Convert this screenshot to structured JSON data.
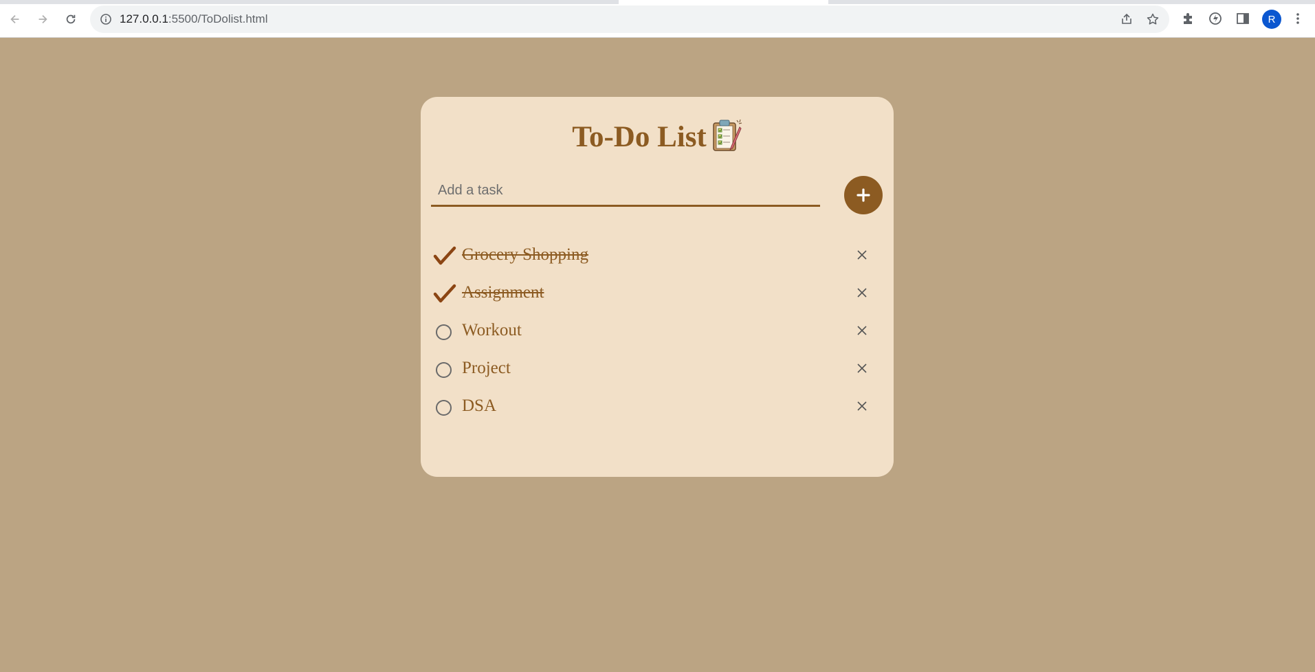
{
  "browser": {
    "url_host": "127.0.0.1",
    "url_path": ":5500/ToDolist.html",
    "profile_initial": "R"
  },
  "app": {
    "title": "To-Do List",
    "title_icon": "clipboard-checklist-emoji",
    "input_placeholder": "Add a task",
    "add_icon": "plus-icon",
    "delete_icon": "close-icon",
    "tasks": [
      {
        "label": "Grocery Shopping",
        "done": true
      },
      {
        "label": "Assignment",
        "done": true
      },
      {
        "label": "Workout",
        "done": false
      },
      {
        "label": "Project",
        "done": false
      },
      {
        "label": "DSA",
        "done": false
      }
    ]
  },
  "colors": {
    "page_background": "#bba483",
    "card_background": "#f2e0c8",
    "accent": "#8c5b22"
  }
}
